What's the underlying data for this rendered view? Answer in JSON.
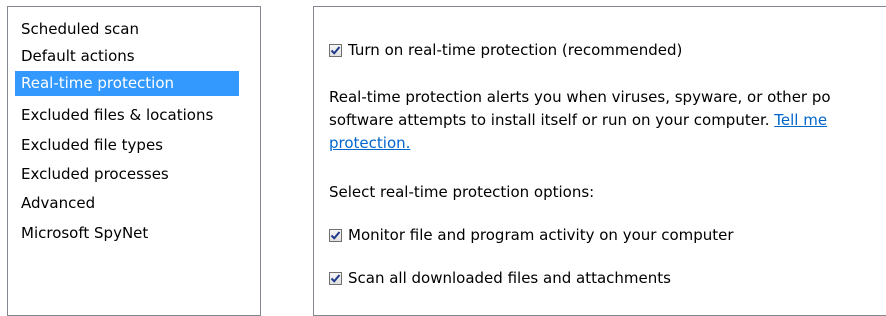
{
  "sidebar": {
    "items": [
      {
        "label": "Scheduled scan"
      },
      {
        "label": "Default actions"
      },
      {
        "label": "Real-time protection",
        "selected": true
      },
      {
        "label": "Excluded files & locations"
      },
      {
        "label": "Excluded file types"
      },
      {
        "label": "Excluded processes"
      },
      {
        "label": "Advanced"
      },
      {
        "label": "Microsoft SpyNet"
      }
    ]
  },
  "content": {
    "main_option": {
      "label": "Turn on real-time protection (recommended)",
      "checked": true
    },
    "description_line1": "Real-time protection alerts you when viruses, spyware, or other po",
    "description_line2": "software attempts to install itself or run on your computer. ",
    "link_part1": "Tell me",
    "link_part2": "protection.",
    "options_heading": "Select real-time protection options:",
    "options": [
      {
        "label": "Monitor file and program activity on your computer",
        "checked": true
      },
      {
        "label": "Scan all downloaded files and attachments",
        "checked": true
      }
    ]
  },
  "colors": {
    "selection": "#3399ff",
    "link": "#0066cc",
    "checkmark": "#1e3a8a"
  }
}
